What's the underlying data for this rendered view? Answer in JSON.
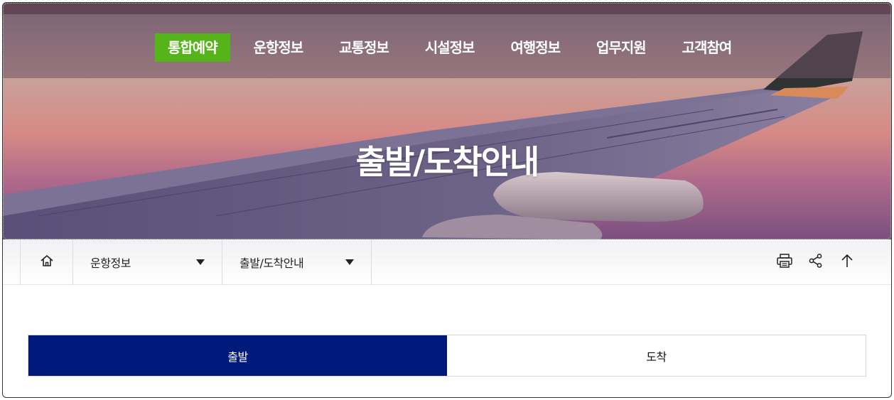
{
  "nav": {
    "items": [
      {
        "label": "통합예약",
        "active": true
      },
      {
        "label": "운항정보",
        "active": false
      },
      {
        "label": "교통정보",
        "active": false
      },
      {
        "label": "시설정보",
        "active": false
      },
      {
        "label": "여행정보",
        "active": false
      },
      {
        "label": "업무지원",
        "active": false
      },
      {
        "label": "고객참여",
        "active": false
      }
    ]
  },
  "hero": {
    "title": "출발/도착안내"
  },
  "breadcrumb": {
    "home_icon": "home-icon",
    "level1": "운항정보",
    "level2": "출발/도착안내"
  },
  "tools": {
    "icons": [
      "print-icon",
      "share-icon",
      "arrow-up-icon"
    ]
  },
  "tabs": [
    {
      "label": "출발",
      "active": true
    },
    {
      "label": "도착",
      "active": false
    }
  ],
  "colors": {
    "nav_active": "#55b41a",
    "tab_active": "#001a7c"
  }
}
